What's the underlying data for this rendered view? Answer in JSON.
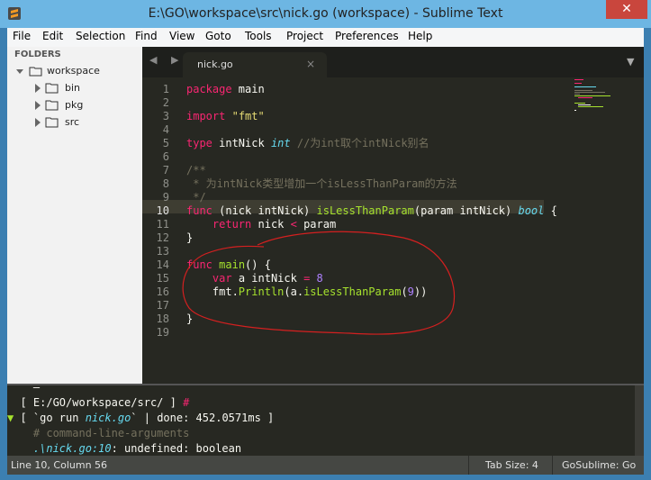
{
  "window": {
    "title": "E:\\GO\\workspace\\src\\nick.go (workspace) - Sublime Text",
    "close_label": "✕"
  },
  "menu": [
    "File",
    "Edit",
    "Selection",
    "Find",
    "View",
    "Goto",
    "Tools",
    "Project",
    "Preferences",
    "Help"
  ],
  "sidebar": {
    "header": "FOLDERS",
    "items": [
      {
        "label": "workspace",
        "expanded": true,
        "level": 0
      },
      {
        "label": "bin",
        "expanded": false,
        "level": 1
      },
      {
        "label": "pkg",
        "expanded": false,
        "level": 1
      },
      {
        "label": "src",
        "expanded": false,
        "level": 1
      }
    ]
  },
  "tabs": {
    "nav_arrows": "◀ ▶",
    "active_label": "nick.go",
    "close_label": "×",
    "menu_icon": "▼"
  },
  "editor": {
    "active_line": 10,
    "line_numbers": [
      "1",
      "2",
      "3",
      "4",
      "5",
      "6",
      "7",
      "8",
      "9",
      "10",
      "11",
      "12",
      "13",
      "14",
      "15",
      "16",
      "17",
      "18",
      "19"
    ],
    "lines": [
      [
        [
          "kw",
          "package"
        ],
        [
          "",
          ""
        ],
        [
          "",
          " main"
        ]
      ],
      [],
      [
        [
          "kw",
          "import"
        ],
        [
          "",
          " "
        ],
        [
          "str",
          "\"fmt\""
        ]
      ],
      [],
      [
        [
          "kw",
          "type"
        ],
        [
          "",
          " intNick "
        ],
        [
          "ty",
          "int"
        ],
        [
          "cm",
          " //为int取个intNick别名"
        ]
      ],
      [],
      [
        [
          "cm",
          "/**"
        ]
      ],
      [
        [
          "cm",
          " * 为intNick类型增加一个isLessThanParam的方法"
        ]
      ],
      [
        [
          "cm",
          " */"
        ]
      ],
      [
        [
          "kw",
          "func"
        ],
        [
          "",
          " (nick intNick) "
        ],
        [
          "fn",
          "isLessThanParam"
        ],
        [
          "",
          "(param intNick) "
        ],
        [
          "ty",
          "bool"
        ],
        [
          "",
          " {"
        ]
      ],
      [
        [
          "",
          "    "
        ],
        [
          "kw",
          "return"
        ],
        [
          "",
          " nick "
        ],
        [
          "kw",
          "<"
        ],
        [
          "",
          " param"
        ]
      ],
      [
        [
          "",
          "}"
        ]
      ],
      [],
      [
        [
          "kw",
          "func"
        ],
        [
          "",
          " "
        ],
        [
          "fn",
          "main"
        ],
        [
          "",
          "() {"
        ]
      ],
      [
        [
          "",
          "    "
        ],
        [
          "kw",
          "var"
        ],
        [
          "",
          " a intNick "
        ],
        [
          "kw",
          "="
        ],
        [
          "",
          " "
        ],
        [
          "num",
          "8"
        ]
      ],
      [
        [
          "",
          "    fmt."
        ],
        [
          "fn",
          "Println"
        ],
        [
          "",
          "(a."
        ],
        [
          "fn",
          "isLessThanParam"
        ],
        [
          "",
          "("
        ],
        [
          "num",
          "9"
        ],
        [
          "",
          "))"
        ]
      ],
      [],
      [
        [
          "",
          "}"
        ]
      ],
      []
    ]
  },
  "console": {
    "lines": [
      [
        [
          "",
          "    "
        ],
        [
          "",
          "—"
        ]
      ],
      [
        [
          "",
          "  [ E:/GO/workspace/src/ ] "
        ],
        [
          "kw",
          "#"
        ]
      ],
      [
        [
          "fn",
          "▼"
        ],
        [
          "",
          " [ `go run "
        ],
        [
          "ty",
          "nick.go"
        ],
        [
          "",
          "` | done: 452.0571ms ]"
        ]
      ],
      [
        [
          "",
          "    "
        ],
        [
          "cm",
          "# command-line-arguments"
        ]
      ],
      [
        [
          "",
          "    "
        ],
        [
          "ty",
          ".\\nick.go:10"
        ],
        [
          "",
          ": undefined: boolean"
        ]
      ]
    ]
  },
  "status": {
    "position": "Line 10, Column 56",
    "tab_size": "Tab Size: 4",
    "syntax": "GoSublime: Go"
  },
  "colors": {
    "editor_bg": "#272822",
    "keyword": "#f92672",
    "string": "#e6db74",
    "type": "#66d9ef",
    "comment": "#75715e",
    "function": "#a6e22e",
    "number": "#ae81ff",
    "annotation_circle": "#d42020"
  },
  "annotation": {
    "shape": "hand-drawn red circle around main function"
  }
}
